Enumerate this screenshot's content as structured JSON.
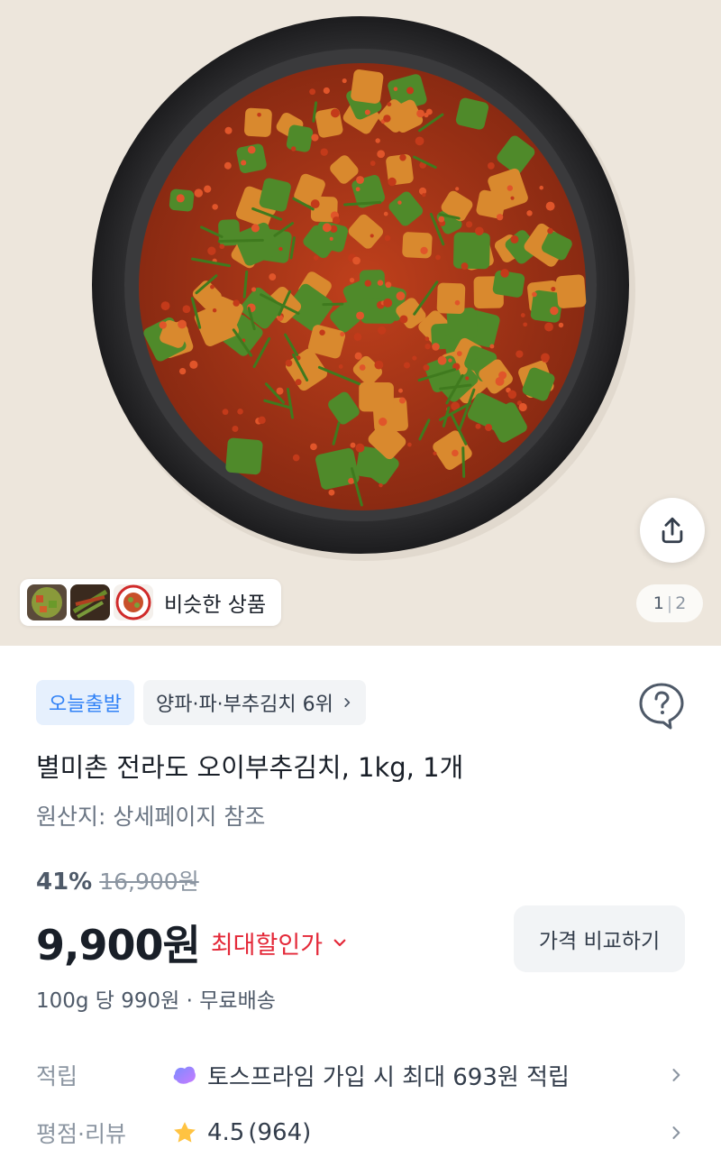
{
  "gallery": {
    "similar_label": "비슷한 상품",
    "page_current": "1",
    "page_separator": "|",
    "page_total": "2"
  },
  "badges": {
    "delivery": "오늘출발",
    "rank": "양파·파·부추김치 6위"
  },
  "product": {
    "title": "별미촌 전라도 오이부추김치, 1kg, 1개",
    "origin": "원산지: 상세페이지 참조"
  },
  "price": {
    "discount_rate": "41%",
    "original": "16,900원",
    "current": "9,900원",
    "max_discount_label": "최대할인가",
    "compare_button": "가격 비교하기",
    "unit_info": "100g 당 990원 · 무료배송"
  },
  "points": {
    "label": "적립",
    "value": "토스프라임 가입 시 최대 693원 적립"
  },
  "review": {
    "label": "평점·리뷰",
    "rating": "4.5",
    "count": "(964)"
  },
  "colors": {
    "accent_blue": "#3182f6",
    "discount_red": "#e42939",
    "star": "#ffc342"
  },
  "icons": [
    "share-icon",
    "question-icon",
    "chevron-right-icon",
    "chevron-down-icon",
    "star-icon",
    "toss-prime-icon"
  ]
}
